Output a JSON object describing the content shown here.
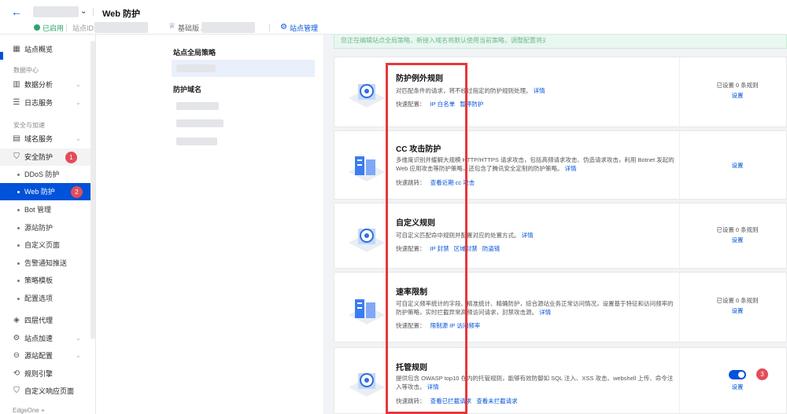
{
  "header": {
    "back_icon": "arrow-left-icon",
    "title": "Web 防护",
    "status_enabled": "已启用",
    "site_id_label": "站点ID:",
    "plan_label": "基础版 /",
    "site_management": "站点管理"
  },
  "sidebar": {
    "items": [
      {
        "label": "站点概览",
        "icon": "grid-icon"
      },
      {
        "group": "数据中心"
      },
      {
        "label": "数据分析",
        "icon": "chart-icon"
      },
      {
        "label": "日志服务",
        "icon": "list-icon"
      },
      {
        "group": "安全与加速"
      },
      {
        "label": "域名服务",
        "icon": "folder-icon"
      },
      {
        "label": "安全防护",
        "icon": "shield-icon"
      },
      {
        "label": "DDoS 防护"
      },
      {
        "label": "Web 防护"
      },
      {
        "label": "Bot 管理"
      },
      {
        "label": "源站防护"
      },
      {
        "label": "自定义页面"
      },
      {
        "label": "告警通知推送"
      },
      {
        "label": "策略模板"
      },
      {
        "label": "配置选项"
      },
      {
        "label": "四层代理",
        "icon": "layers-icon"
      },
      {
        "label": "站点加速",
        "icon": "speed-icon"
      },
      {
        "label": "源站配置",
        "icon": "server-icon"
      },
      {
        "label": "规则引擎",
        "icon": "rule-icon"
      },
      {
        "label": "自定义响应页面",
        "icon": "page-icon"
      }
    ],
    "bottom_group": "EdgeOne +",
    "badge_1": "1",
    "badge_2": "2"
  },
  "strategy": {
    "global_label": "站点全局策略",
    "domain_label": "防护域名"
  },
  "notice": "您正在编辑站点全局策略，新接入域名将默认使用当前策略，调整配置将对 3 个域名生效",
  "cards": [
    {
      "title": "防护例外规则",
      "desc": "对匹配条件的请求，将不经过指定的防护规则处理。",
      "detail": "详情",
      "quick_label": "快速配置：",
      "quick_links": [
        "IP 白名单",
        "暂停防护"
      ],
      "status": "已设置 0 条规则",
      "action": "设置"
    },
    {
      "title": "CC 攻击防护",
      "desc": "多维度识别并缓解大规模 HTTP/HTTPS 请求攻击，包括高频请求攻击、伪造请求攻击，利用 Botnet 发起的 Web 应用攻击等防护策略，还包含了腾讯安全定制的防护策略。",
      "detail": "详情",
      "quick_label": "快速跳转：",
      "quick_links": [
        "查看近期 cc 攻击"
      ],
      "status": "",
      "action": "设置"
    },
    {
      "title": "自定义规则",
      "desc": "可自定义匹配命中规则并配置对应的处置方式。",
      "detail": "详情",
      "quick_label": "快速配置：",
      "quick_links": [
        "IP 封禁",
        "区域封禁",
        "防盗链"
      ],
      "status": "已设置 0 条规则",
      "action": "设置"
    },
    {
      "title": "速率限制",
      "desc": "可自定义频率统计的字段、精准统计、精确防护，综合源站业务正常访问情况，设置基于特征和访问频率的防护策略，实时拦截异常高频访问请求，封禁攻击源。",
      "detail": "详情",
      "quick_label": "快速配置：",
      "quick_links": [
        "限制源 IP 访问频率"
      ],
      "status": "已设置 0 条规则",
      "action": "设置"
    },
    {
      "title": "托管规则",
      "desc": "提供包含 OWASP top10 在内的托管规则，能够有效防御如 SQL 注入、XSS 攻击、webshell 上传、命令注入等攻击。",
      "detail": "详情",
      "quick_label": "快速跳转：",
      "quick_links": [
        "查看已拦截请求",
        "查看未拦截请求"
      ],
      "status": "",
      "action": "设置",
      "badge": "3"
    }
  ],
  "colors": {
    "primary": "#0052d9",
    "success": "#2ba471",
    "danger": "#e34d59",
    "frame": "#e5383b"
  }
}
